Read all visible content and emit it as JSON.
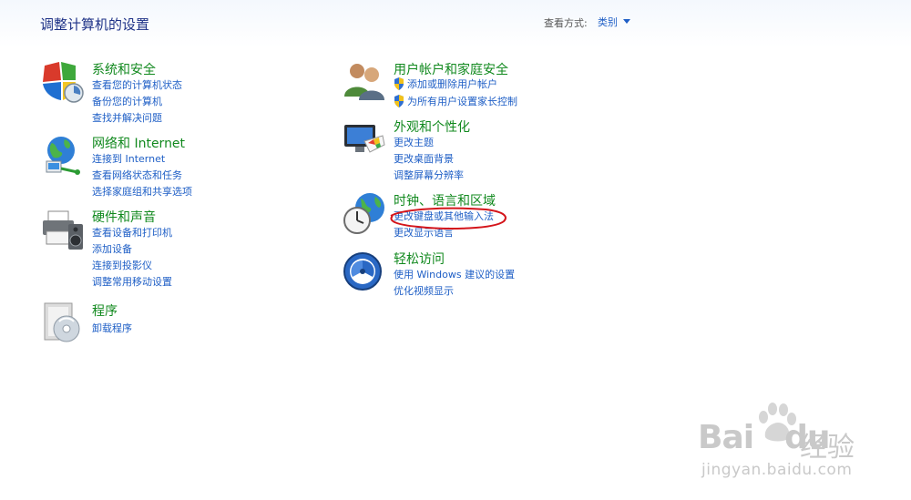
{
  "header": {
    "title": "调整计算机的设置",
    "view_by_label": "查看方式:",
    "view_by_value": "类别"
  },
  "categories": [
    {
      "title": "系统和安全",
      "icon": "security-shield-icon",
      "links": [
        "查看您的计算机状态",
        "备份您的计算机",
        "查找并解决问题"
      ]
    },
    {
      "title": "网络和 Internet",
      "icon": "network-globe-icon",
      "links": [
        "连接到 Internet",
        "查看网络状态和任务",
        "选择家庭组和共享选项"
      ]
    },
    {
      "title": "硬件和声音",
      "icon": "printer-speaker-icon",
      "links": [
        "查看设备和打印机",
        "添加设备",
        "连接到投影仪",
        "调整常用移动设置"
      ]
    },
    {
      "title": "程序",
      "icon": "programs-disc-icon",
      "links": [
        "卸载程序"
      ]
    },
    {
      "title": "用户帐户和家庭安全",
      "icon": "users-icon",
      "links": [
        "添加或删除用户帐户",
        "为所有用户设置家长控制"
      ]
    },
    {
      "title": "外观和个性化",
      "icon": "monitor-palette-icon",
      "links": [
        "更改主题",
        "更改桌面背景",
        "调整屏幕分辨率"
      ]
    },
    {
      "title": "时钟、语言和区域",
      "icon": "clock-globe-icon",
      "links": [
        "更改键盘或其他输入法",
        "更改显示语言"
      ]
    },
    {
      "title": "轻松访问",
      "icon": "ease-of-access-icon",
      "links": [
        "使用 Windows 建议的设置",
        "优化视频显示"
      ]
    }
  ],
  "watermark": {
    "brand": "Bai",
    "brand2": "du",
    "brand_cn": "经验",
    "url": "jingyan.baidu.com"
  },
  "colors": {
    "title": "#1e3287",
    "category": "#11891e",
    "link": "#1f5fc6",
    "annotation": "#d4151b"
  }
}
